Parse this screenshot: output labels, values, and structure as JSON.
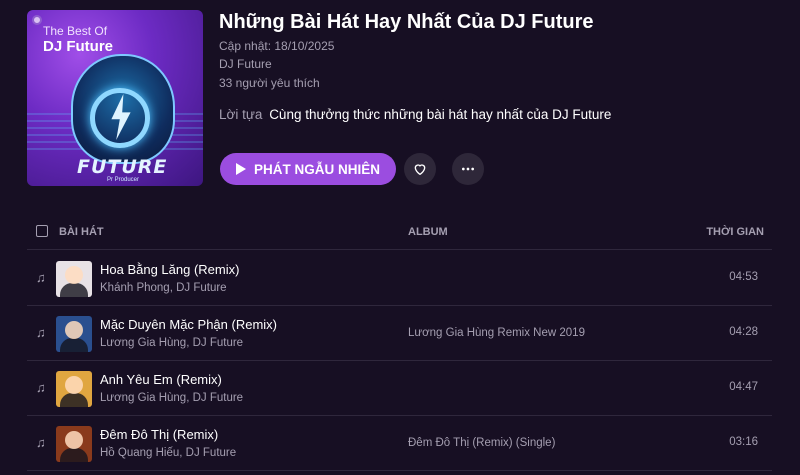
{
  "playlist": {
    "cover": {
      "line1": "The Best Of",
      "line2": "DJ Future",
      "logo": "FUTURE",
      "logo_sub": "Pr Producer"
    },
    "title": "Những Bài Hát Hay Nhất Của DJ Future",
    "updated": "Cập nhật: 18/10/2025",
    "artist": "DJ Future",
    "likes": "33 người yêu thích",
    "description_label": "Lời tựa",
    "description": "Cùng thưởng thức những bài hát hay nhất của DJ Future"
  },
  "actions": {
    "play_label": "PHÁT NGẪU NHIÊN",
    "heart_icon": "heart-icon",
    "more_icon": "more-icon"
  },
  "table": {
    "headers": {
      "song": "BÀI HÁT",
      "album": "ALBUM",
      "time": "THỜI GIAN"
    },
    "rows": [
      {
        "title": "Hoa Bằng Lăng (Remix)",
        "artists": "Khánh Phong, DJ Future",
        "album": "",
        "duration": "04:53",
        "thumb_color": "#e8e2e6"
      },
      {
        "title": "Mặc Duyên Mặc Phận (Remix)",
        "artists": "Lương Gia Hùng, DJ Future",
        "album": "Lương Gia Hùng Remix New 2019",
        "duration": "04:28",
        "thumb_color": "#2a4f8f"
      },
      {
        "title": "Anh Yêu Em (Remix)",
        "artists": "Lương Gia Hùng, DJ Future",
        "album": "",
        "duration": "04:47",
        "thumb_color": "#e0a640"
      },
      {
        "title": "Đêm Đô Thị (Remix)",
        "artists": "Hồ Quang Hiếu, DJ Future",
        "album": "Đêm Đô Thị (Remix) (Single)",
        "duration": "03:16",
        "thumb_color": "#8a3a1c"
      }
    ]
  },
  "colors": {
    "background": "#170f23",
    "accent": "#9b4de0",
    "secondary_text": "#a59fb1"
  }
}
